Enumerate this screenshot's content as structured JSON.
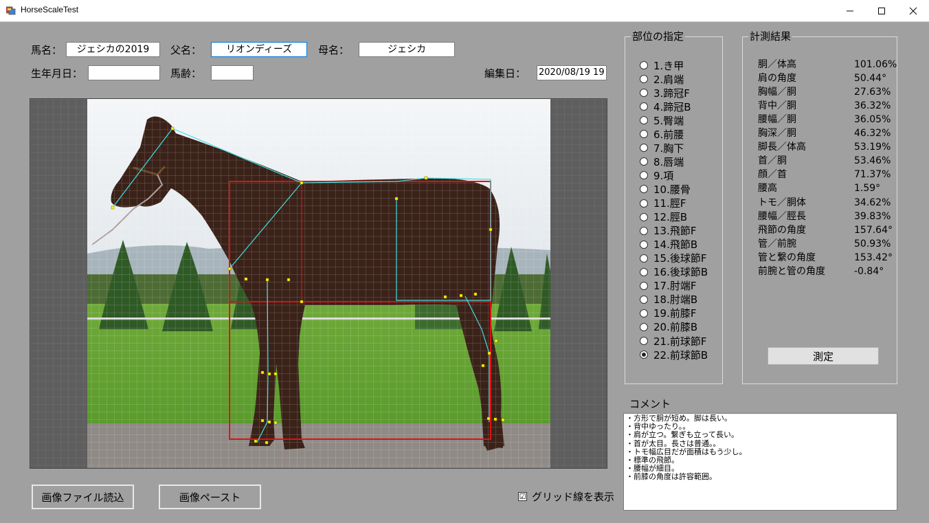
{
  "window": {
    "title": "HorseScaleTest"
  },
  "form": {
    "horse_name_label": "馬名：",
    "horse_name_value": "ジェシカの2019",
    "sire_label": "父名：",
    "sire_value": "リオンディーズ",
    "dam_label": "母名：",
    "dam_value": "ジェシカ",
    "birthdate_label": "生年月日：",
    "birthdate_value": "",
    "age_label": "馬齢：",
    "age_value": "",
    "edit_date_label": "編集日：",
    "edit_date_value": "2020/08/19 19"
  },
  "parts": {
    "title": "部位の指定",
    "items": [
      "1.き甲",
      "2.肩端",
      "3.蹄冠F",
      "4.蹄冠B",
      "5.臀端",
      "6.前腰",
      "7.胸下",
      "8.唇端",
      "9.項",
      "10.腰骨",
      "11.脛F",
      "12.脛B",
      "13.飛節F",
      "14.飛節B",
      "15.後球節F",
      "16.後球節B",
      "17.肘端F",
      "18.肘端B",
      "19.前膝F",
      "20.前膝B",
      "21.前球節F",
      "22.前球節B"
    ],
    "selected": "22.前球節B"
  },
  "results": {
    "title": "計測結果",
    "rows": [
      {
        "label": "胴／体高",
        "value": "101.06%"
      },
      {
        "label": "肩の角度",
        "value": "50.44°"
      },
      {
        "label": "胸幅／胴",
        "value": "27.63%"
      },
      {
        "label": "背中／胴",
        "value": "36.32%"
      },
      {
        "label": "腰幅／胴",
        "value": "36.05%"
      },
      {
        "label": "胸深／胴",
        "value": "46.32%"
      },
      {
        "label": "脚長／体高",
        "value": "53.19%"
      },
      {
        "label": "首／胴",
        "value": "53.46%"
      },
      {
        "label": "顔／首",
        "value": "71.37%"
      },
      {
        "label": "腰高",
        "value": "1.59°"
      },
      {
        "label": "トモ／胴体",
        "value": "34.62%"
      },
      {
        "label": "腰幅／脛長",
        "value": "39.83%"
      },
      {
        "label": "飛節の角度",
        "value": "157.64°"
      },
      {
        "label": "管／前腕",
        "value": "50.93%"
      },
      {
        "label": "管と繋の角度",
        "value": "153.42°"
      },
      {
        "label": "前腕と管の角度",
        "value": "-0.84°"
      }
    ],
    "measure_button": "測定"
  },
  "comment": {
    "label": "コメント",
    "lines": [
      "・方形で胴が短め。脚は長い。",
      "・背中ゆったり。。",
      "・肩が立つ。繋ぎも立って長い。",
      "・首が太目。長さは普通。。",
      "・トモ幅広目だが面積はもう少し。",
      "・標準の飛節。",
      "・腰幅が細目。",
      "・前膝の角度は許容範囲。"
    ]
  },
  "buttons": {
    "load_image": "画像ファイル読込",
    "paste_image": "画像ペースト",
    "grid_checkbox": "グリッド線を表示",
    "grid_checked": "☑"
  },
  "colors": {
    "form_bg": "#a0a0a0",
    "overlay_cyan": "#40e0e0",
    "overlay_red": "#e01010",
    "point_yellow": "#ffff00",
    "horse_brown": "#3b2218"
  },
  "icons": [
    "app-icon",
    "minimize-icon",
    "maximize-icon",
    "close-icon"
  ]
}
